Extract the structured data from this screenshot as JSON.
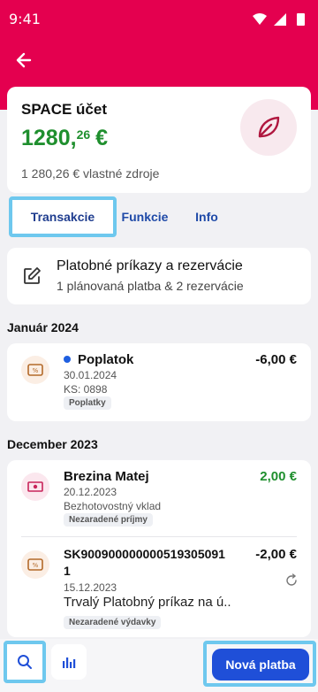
{
  "status_bar": {
    "time": "9:41"
  },
  "account": {
    "name": "SPACE účet",
    "balance_int": "1280,",
    "balance_dec": "26",
    "currency": "€",
    "own_funds": "1 280,26 € vlastné zdroje"
  },
  "tabs": [
    {
      "label": "Transakcie",
      "active": true
    },
    {
      "label": "Funkcie",
      "active": false
    },
    {
      "label": "Info",
      "active": false
    }
  ],
  "orders": {
    "title": "Platobné príkazy a rezervácie",
    "subtitle": "1 plánovaná platba & 2 rezervácie"
  },
  "sections": [
    {
      "title": "Január 2024",
      "transactions": [
        {
          "title": "Poplatok",
          "date": "30.01.2024",
          "meta": "KS: 0898",
          "tag": "Poplatky",
          "amount": "-6,00 €",
          "icon": "fee-wallet-icon"
        }
      ]
    },
    {
      "title": "December 2023",
      "transactions": [
        {
          "title": "Brezina Matej",
          "date": "20.12.2023",
          "meta": "Bezhotovostný vklad",
          "tag": "Nezaradené príjmy",
          "amount": "2,00 €",
          "icon": "cash-icon"
        },
        {
          "title_line1": "SK900900000000519305091",
          "title_line2": "1",
          "date": "15.12.2023",
          "meta": "Trvalý Platobný príkaz na ú..",
          "tag": "Nezaradené výdavky",
          "amount": "-2,00 €",
          "icon": "fee-wallet-icon"
        }
      ]
    }
  ],
  "bottom": {
    "new_payment": "Nová platba"
  },
  "colors": {
    "brand": "#e4004f",
    "positive": "#1f8f2e",
    "primary": "#1f4fd8"
  }
}
